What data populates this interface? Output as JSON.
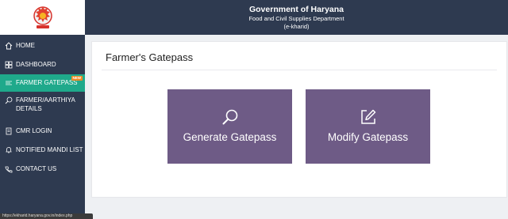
{
  "header": {
    "title": "Government of Haryana",
    "department": "Food and Civil Supplies Department",
    "subtitle": "(e-kharid)"
  },
  "sidebar": {
    "items": [
      {
        "label": "HOME",
        "icon": "home-icon"
      },
      {
        "label": "DASHBOARD",
        "icon": "dashboard-icon"
      },
      {
        "label": "FARMER GATEPASS",
        "icon": "gatepass-icon",
        "active": true,
        "badge": "NEW"
      },
      {
        "label": "FARMER/AARTHIYA",
        "label2": "DETAILS",
        "icon": "search-icon"
      },
      {
        "label": "CMR LOGIN",
        "icon": "document-icon"
      },
      {
        "label": "NOTIFIED MANDI LIST",
        "icon": "bell-icon"
      },
      {
        "label": "CONTACT US",
        "icon": "phone-icon"
      }
    ]
  },
  "main": {
    "title": "Farmer's Gatepass",
    "tiles": [
      {
        "label": "Generate Gatepass",
        "icon": "search-icon"
      },
      {
        "label": "Modify Gatepass",
        "icon": "edit-icon"
      }
    ]
  },
  "status_bar": {
    "url": "https://ekharid.haryana.gov.in/index.php"
  },
  "colors": {
    "sidebar_bg": "#2e3a50",
    "active_item": "#1fa98b",
    "tile_bg": "#6e5b86",
    "badge": "#f08a24"
  }
}
